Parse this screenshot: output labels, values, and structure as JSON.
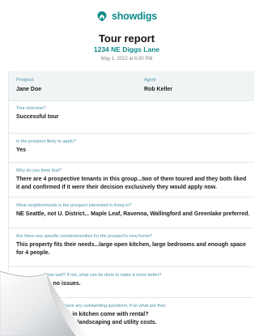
{
  "brand": {
    "name": "showdigs",
    "color": "#0f8a8a",
    "icon": "house-pin-icon"
  },
  "report": {
    "title": "Tour report",
    "address": "1234 NE Diggs Lane",
    "datetime": "May 1, 2022 at 6:00 PM"
  },
  "prospect": {
    "label": "Prospect",
    "value": "Jane Doe"
  },
  "agent": {
    "label": "Agent",
    "value": "Rob Keller"
  },
  "qa": [
    {
      "q": "Tour outcome?",
      "a": "Successful tour"
    },
    {
      "q": "Is the prospect likely to apply?",
      "a": "Yes"
    },
    {
      "q": "Why do you think that?",
      "a": "There are 4 prospective tenants in this group...two of them toured and they both liked it and confirmed if it were their decision exclusively they would apply now."
    },
    {
      "q": "What neighborhoods is the prospect interested in living in?",
      "a": "NE Seattle, not U. District... Maple Leaf, Ravenna, Wallingford and Greenlake preferred."
    },
    {
      "q": "Are there any specific needs/amenities for the prospect's new home?",
      "a": "This property fits their needs...large open kitchen, large bedrooms and enough space for 4 people."
    },
    {
      "q": "Does the unit show well? If not, what can be done to make it show better?",
      "a": "Shows great, no issues."
    },
    {
      "q": "h have any outstanding questions, if so what are they",
      "a": "and in kitchen come with rental?\nate of landscaping and utility costs."
    }
  ],
  "colors": {
    "accent": "#0f8a8a",
    "label": "#4a92a8",
    "row_bg": "#f0f4f5",
    "border": "#e3e8ea"
  }
}
